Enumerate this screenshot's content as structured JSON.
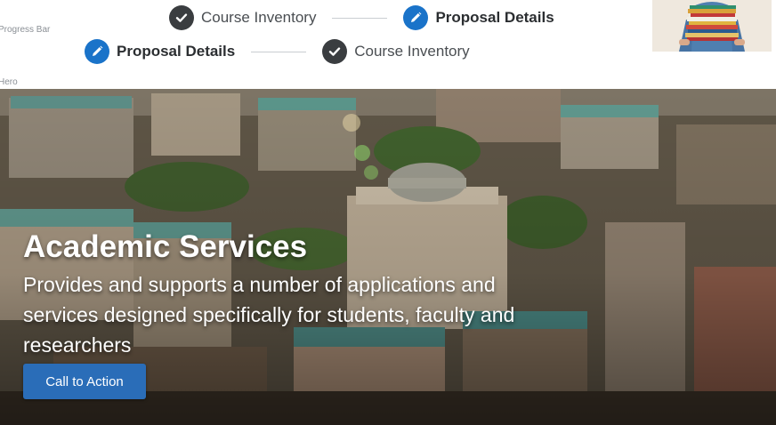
{
  "sections": {
    "progress_bar_label": "Progress Bar",
    "hero_label": "Hero"
  },
  "progress_bar_1": {
    "steps": [
      {
        "label": "Course Inventory",
        "state": "done",
        "icon": "check-icon"
      },
      {
        "label": "Proposal Details",
        "state": "active",
        "icon": "pencil-icon"
      }
    ]
  },
  "progress_bar_2": {
    "steps": [
      {
        "label": "Proposal Details",
        "state": "active",
        "icon": "pencil-icon"
      },
      {
        "label": "Course Inventory",
        "state": "done",
        "icon": "check-icon"
      }
    ]
  },
  "hero": {
    "title": "Academic Services",
    "description": "Provides and supports a number of applications and services designed specifically for students, faculty and researchers",
    "cta_label": "Call to Action"
  },
  "colors": {
    "active_step": "#1a73c9",
    "done_step": "#3a3d40",
    "cta_button": "#2a6db8",
    "connector": "#c9cdd1"
  }
}
